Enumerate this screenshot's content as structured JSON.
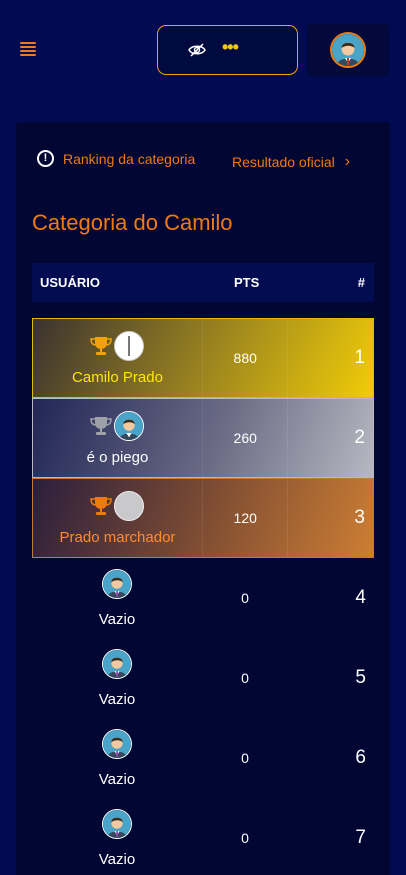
{
  "header": {
    "menu_icon": "hamburger-icon",
    "balance_icon": "eye-off-icon",
    "balance_hidden_text": "•••",
    "avatar_icon": "user-avatar-icon",
    "accent": "#f07a12"
  },
  "info": {
    "ranking_label": "Ranking da categoria",
    "result_label": "Resultado oficial",
    "result_chevron": "›"
  },
  "category_title": "Categoria do Camilo",
  "table": {
    "col_user": "USUÁRIO",
    "col_pts": "PTS",
    "col_rank": "#",
    "rows": [
      {
        "name": "Camilo Prado",
        "pts": "880",
        "rank": "1",
        "tier": "gold",
        "trophy": "gold-trophy-icon"
      },
      {
        "name": "é o piego",
        "pts": "260",
        "rank": "2",
        "tier": "silver",
        "trophy": "silver-trophy-icon"
      },
      {
        "name": "Prado marchador",
        "pts": "120",
        "rank": "3",
        "tier": "bronze",
        "trophy": "bronze-trophy-icon"
      },
      {
        "name": "Vazio",
        "pts": "0",
        "rank": "4",
        "tier": "plain"
      },
      {
        "name": "Vazio",
        "pts": "0",
        "rank": "5",
        "tier": "plain"
      },
      {
        "name": "Vazio",
        "pts": "0",
        "rank": "6",
        "tier": "plain"
      },
      {
        "name": "Vazio",
        "pts": "0",
        "rank": "7",
        "tier": "plain"
      }
    ]
  },
  "colors": {
    "background": "#020b52",
    "card": "#010633",
    "gold": "#f0cc08",
    "silver": "#b7b8c1",
    "bronze": "#cd7e33"
  }
}
